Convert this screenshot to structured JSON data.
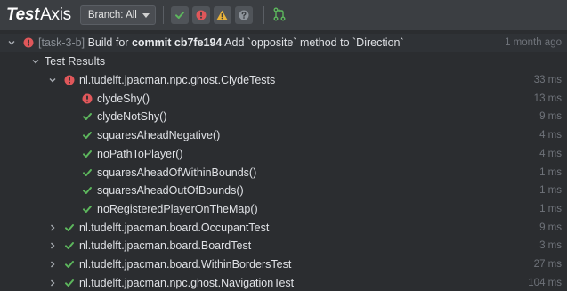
{
  "app": {
    "logo_bold": "Test",
    "logo_rest": "Axis"
  },
  "toolbar": {
    "branch_label": "Branch: All",
    "filters": [
      {
        "icon": "check-icon",
        "color": "#5db75d"
      },
      {
        "icon": "error-icon",
        "color": "#e0575a"
      },
      {
        "icon": "warning-icon",
        "color": "#e8b23a"
      },
      {
        "icon": "help-icon",
        "color": "#8e949b"
      }
    ],
    "git_icon_color": "#5db75d"
  },
  "run": {
    "prefix": "[task-3-b]",
    "text_before": "Build for",
    "commit_label": "commit cb7fe194",
    "text_after": "Add `opposite` method to `Direction`",
    "age": "1 month ago",
    "status": "failed"
  },
  "group": {
    "label": "Test Results"
  },
  "suites": [
    {
      "name": "nl.tudelft.jpacman.npc.ghost.ClydeTests",
      "status": "failed",
      "duration": "33 ms",
      "expanded": true,
      "tests": [
        {
          "name": "clydeShy()",
          "status": "failed",
          "duration": "13 ms"
        },
        {
          "name": "clydeNotShy()",
          "status": "passed",
          "duration": "9 ms"
        },
        {
          "name": "squaresAheadNegative()",
          "status": "passed",
          "duration": "4 ms"
        },
        {
          "name": "noPathToPlayer()",
          "status": "passed",
          "duration": "4 ms"
        },
        {
          "name": "squaresAheadOfWithinBounds()",
          "status": "passed",
          "duration": "1 ms"
        },
        {
          "name": "squaresAheadOutOfBounds()",
          "status": "passed",
          "duration": "1 ms"
        },
        {
          "name": "noRegisteredPlayerOnTheMap()",
          "status": "passed",
          "duration": "1 ms"
        }
      ]
    },
    {
      "name": "nl.tudelft.jpacman.board.OccupantTest",
      "status": "passed",
      "duration": "9 ms",
      "expanded": false
    },
    {
      "name": "nl.tudelft.jpacman.board.BoardTest",
      "status": "passed",
      "duration": "3 ms",
      "expanded": false
    },
    {
      "name": "nl.tudelft.jpacman.board.WithinBordersTest",
      "status": "passed",
      "duration": "27 ms",
      "expanded": false
    },
    {
      "name": "nl.tudelft.jpacman.npc.ghost.NavigationTest",
      "status": "passed",
      "duration": "104 ms",
      "expanded": false
    }
  ],
  "colors": {
    "passed": "#5db75d",
    "failed": "#e0575a",
    "chevron": "#a9adb3"
  }
}
